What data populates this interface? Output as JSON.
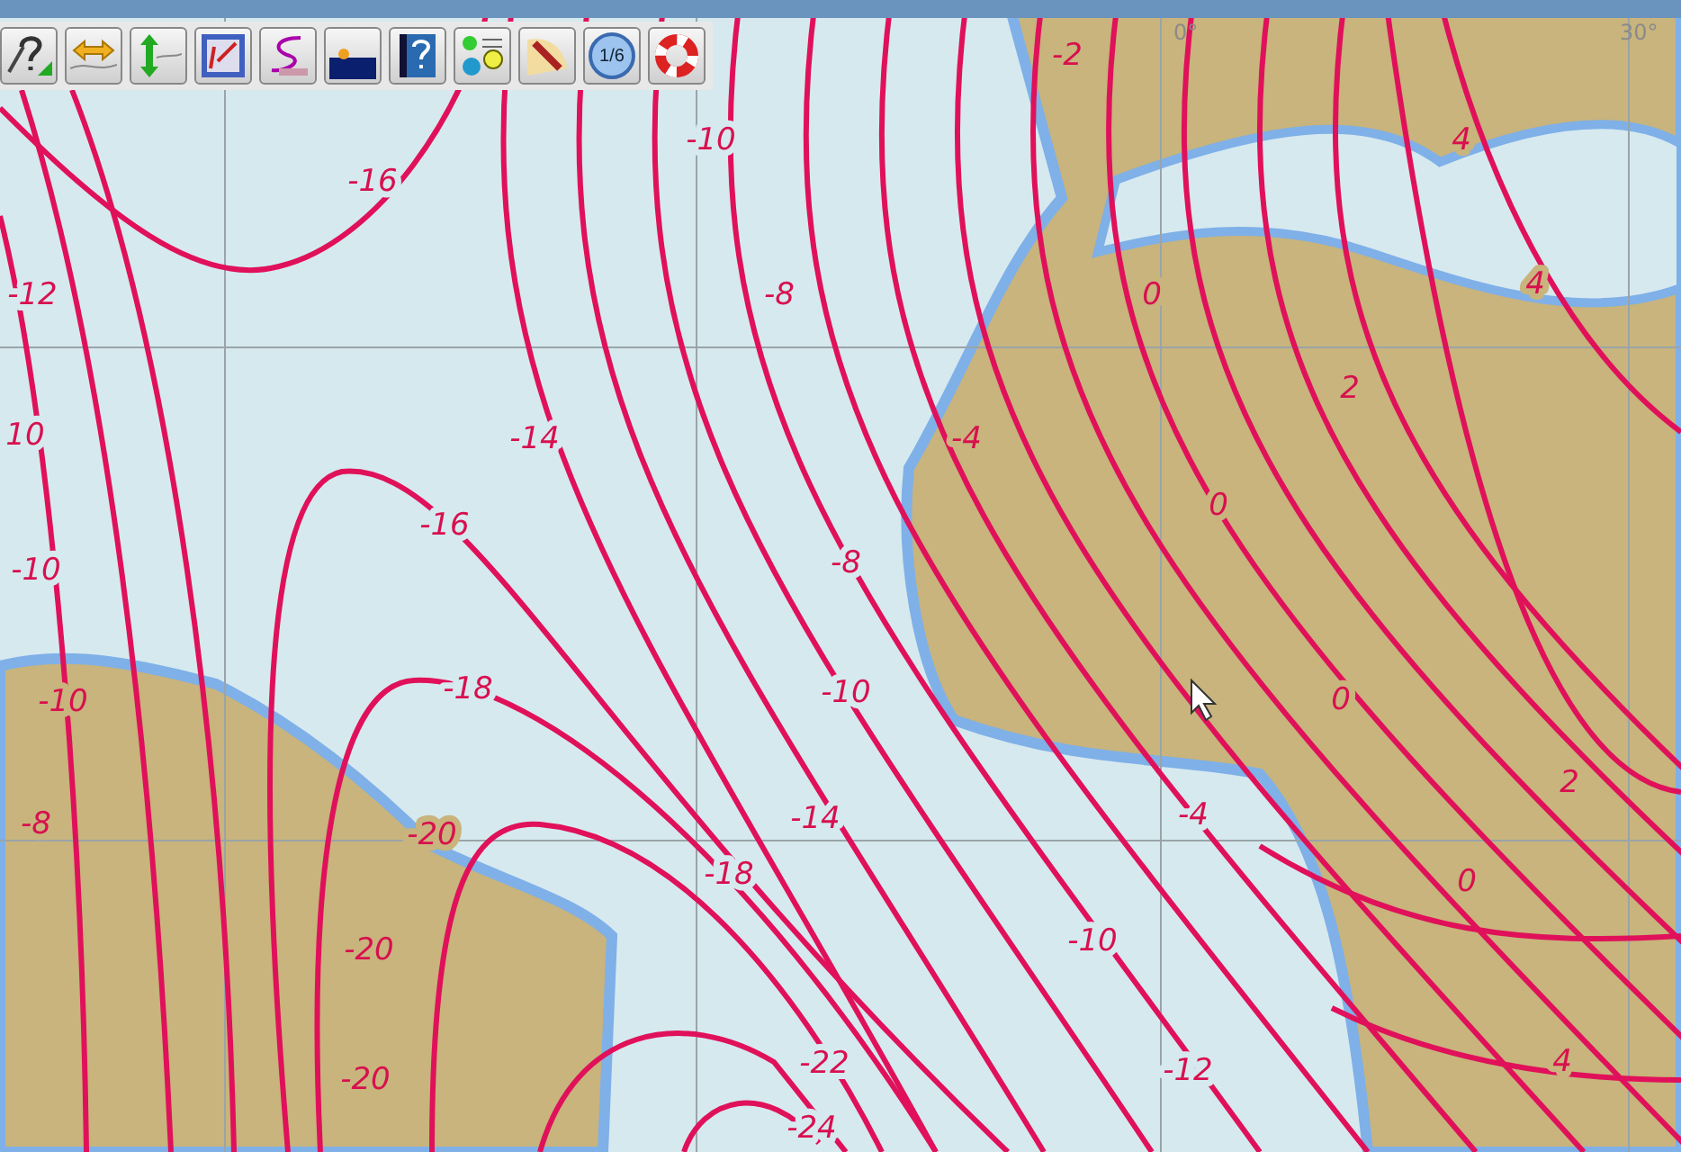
{
  "toolbar": {
    "scale_badge": "1/6"
  },
  "map": {
    "graticule_labels": [
      "0°",
      "30°"
    ],
    "isoline_labels": [
      "-2",
      "-10",
      "4",
      "-16",
      "-12",
      "-8",
      "0",
      "4",
      "2",
      "10",
      "-14",
      "-4",
      "-16",
      "0",
      "-10",
      "-8",
      "-10",
      "-18",
      "-10",
      "0",
      "2",
      "-8",
      "-20",
      "-14",
      "-4",
      "-18",
      "0",
      "-20",
      "-10",
      "-20",
      "-22",
      "-12",
      "4",
      "-24"
    ]
  }
}
